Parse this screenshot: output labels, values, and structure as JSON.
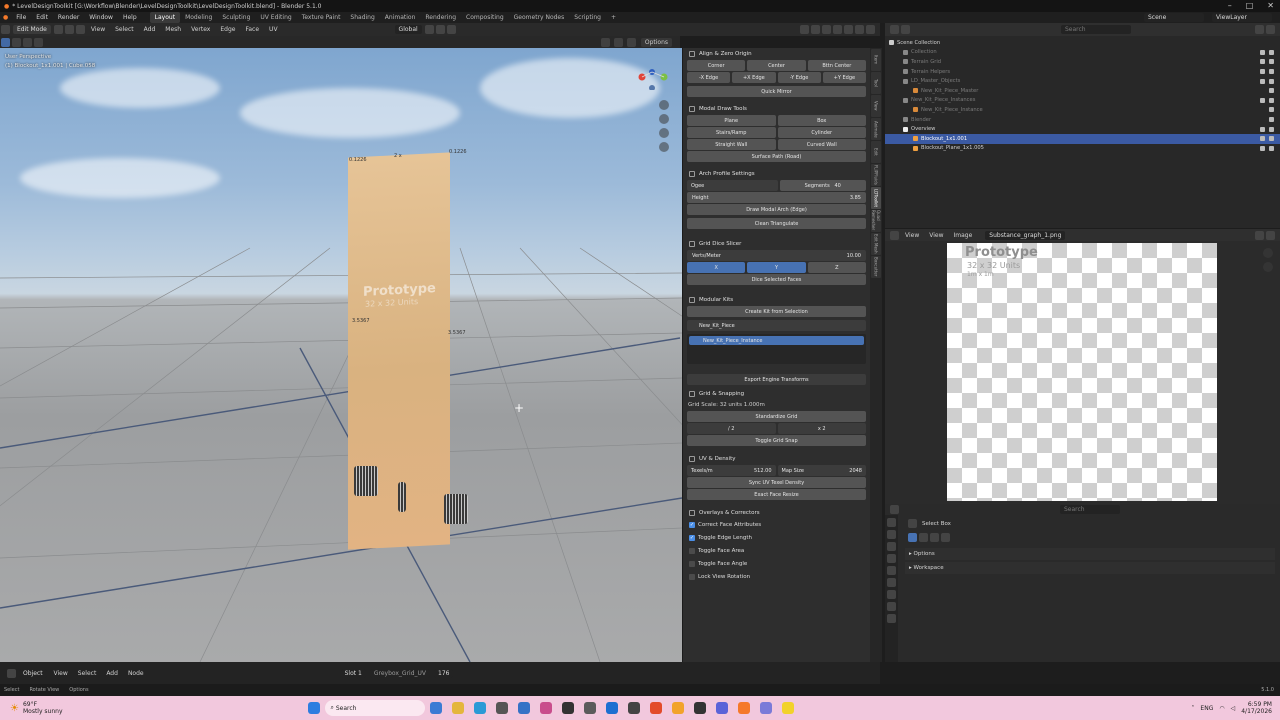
{
  "window": {
    "title": "* LevelDesignToolkit [G:\\Workflow\\Blender\\LevelDesignToolkit\\LevelDesignToolkit.blend] - Blender 5.1.0"
  },
  "menu": {
    "items": [
      "File",
      "Edit",
      "Render",
      "Window",
      "Help"
    ]
  },
  "workspaces": [
    "Layout",
    "Modeling",
    "Sculpting",
    "UV Editing",
    "Texture Paint",
    "Shading",
    "Animation",
    "Rendering",
    "Compositing",
    "Geometry Nodes",
    "Scripting"
  ],
  "topright": {
    "scene": "Scene",
    "viewlayer": "ViewLayer"
  },
  "viewport_header": {
    "mode": "Edit Mode",
    "menus": [
      "View",
      "Select",
      "Add",
      "Mesh",
      "Vertex",
      "Edge",
      "Face",
      "UV"
    ],
    "orientation": "Global",
    "options": "Options"
  },
  "viewport": {
    "view_name": "User Perspective",
    "object_info": "(1) Blockout_1x1.001 | Cube.058",
    "prototype_title": "Prototype",
    "prototype_sub": "32 x 32 Units",
    "dim_top_left": "0.1226",
    "dim_top_mid": "2 x",
    "dim_top_right": "0.1226",
    "dim_left": "3.5367",
    "dim_right": "3.5367"
  },
  "panel": {
    "align_title": "Align & Zero Origin",
    "align_row1": [
      "Corner",
      "Center",
      "Bttn Center"
    ],
    "align_row2": [
      "-X Edge",
      "+X Edge",
      "-Y Edge",
      "+Y Edge"
    ],
    "quick_mirror": "Quick Mirror",
    "modal_title": "Modal Draw Tools",
    "modal_row1": [
      "Plane",
      "Box"
    ],
    "modal_row2": [
      "Stairs/Ramp",
      "Cylinder"
    ],
    "modal_row3": [
      "Straight Wall",
      "Curved Wall"
    ],
    "surface_path": "Surface Path (Road)",
    "arch_title": "Arch Profile Settings",
    "arch_type": "Ogee",
    "arch_segments_label": "Segments",
    "arch_segments": "40",
    "arch_height_label": "Height",
    "arch_height": "3.85",
    "draw_arch": "Draw Modal Arch (Edge)",
    "clean_tri": "Clean Triangulate",
    "grid_title": "Grid Dice Slicer",
    "verts_label": "Verts/Meter",
    "verts_val": "10.00",
    "axis_x": "X",
    "axis_y": "Y",
    "axis_z": "Z",
    "dice": "Dice Selected Faces",
    "kits_title": "Modular Kits",
    "create_kit": "Create Kit from Selection",
    "kit_name": "New_Kit_Piece",
    "kit_instance": "New_Kit_Piece_Instance",
    "export_engine": "Export Engine Transforms",
    "snap_title": "Grid & Snapping",
    "grid_scale": "Grid Scale: 32 units  1.000m",
    "std_grid": "Standardize Grid",
    "half": "/ 2",
    "double": "x 2",
    "toggle_snap": "Toggle Grid Snap",
    "uv_title": "UV & Density",
    "texels_label": "Texels/m",
    "texels_val": "512.00",
    "map_label": "Map Size",
    "map_val": "2048",
    "sync_texel": "Sync UV Texel Density",
    "exact_face": "Exact Face Resize",
    "overlay_title": "Overlays & Correctors",
    "checks": [
      {
        "label": "Correct Face Attributes",
        "on": true
      },
      {
        "label": "Toggle Edge Length",
        "on": true
      },
      {
        "label": "Toggle Face Area",
        "on": false
      },
      {
        "label": "Toggle Face Angle",
        "on": false
      },
      {
        "label": "Lock View Rotation",
        "on": false
      }
    ]
  },
  "side_tabs": [
    "Item",
    "Tool",
    "View",
    "Animate",
    "Edit",
    "FLIPFluids",
    "LDToolkit",
    "Quad Remesher",
    "Edit Mesh",
    "Boxcutter"
  ],
  "outliner": {
    "search": "Search",
    "rows": [
      {
        "label": "Scene Collection",
        "cls": "",
        "indent": 0
      },
      {
        "label": "Collection",
        "cls": "dim",
        "indent": 1
      },
      {
        "label": "Terrain Grid",
        "cls": "dim",
        "indent": 1
      },
      {
        "label": "Terrain Helpers",
        "cls": "dim",
        "indent": 1
      },
      {
        "label": "LD_Master_Objects",
        "cls": "dim",
        "indent": 1
      },
      {
        "label": "New_Kit_Piece_Master",
        "cls": "dim",
        "indent": 2
      },
      {
        "label": "New_Kit_Piece_Instances",
        "cls": "dim",
        "indent": 1
      },
      {
        "label": "New_Kit_Piece_Instance",
        "cls": "dim",
        "indent": 2
      },
      {
        "label": "Blender",
        "cls": "dim",
        "indent": 1
      },
      {
        "label": "Overview",
        "cls": "",
        "indent": 1
      },
      {
        "label": "Blockout_1x1.001",
        "cls": "sel",
        "indent": 2
      },
      {
        "label": "Blockout_Plane_1x1.005",
        "cls": "",
        "indent": 2
      }
    ]
  },
  "image_editor": {
    "menus": [
      "View",
      "View",
      "Image"
    ],
    "image_name": "Substance_graph_1.png",
    "title": "Prototype",
    "sub": "32 x 32 Units",
    "sub2": "1m x 1m"
  },
  "properties": {
    "search": "Search",
    "tool": "Select Box",
    "options": "Options",
    "workspace": "Workspace"
  },
  "bottom": {
    "object": "Object",
    "menus": [
      "View",
      "Select",
      "Add",
      "Node"
    ],
    "slot": "Slot 1",
    "material": "Greybox_Grid_UV",
    "users": "176"
  },
  "status": {
    "left": [
      "Select",
      "Rotate View",
      "Options"
    ],
    "version": "5.1.0"
  },
  "taskbar": {
    "weather_temp": "69°F",
    "weather": "Mostly sunny",
    "search": "Search",
    "lang": "ENG",
    "time": "6:59 PM",
    "date": "4/17/2026"
  }
}
